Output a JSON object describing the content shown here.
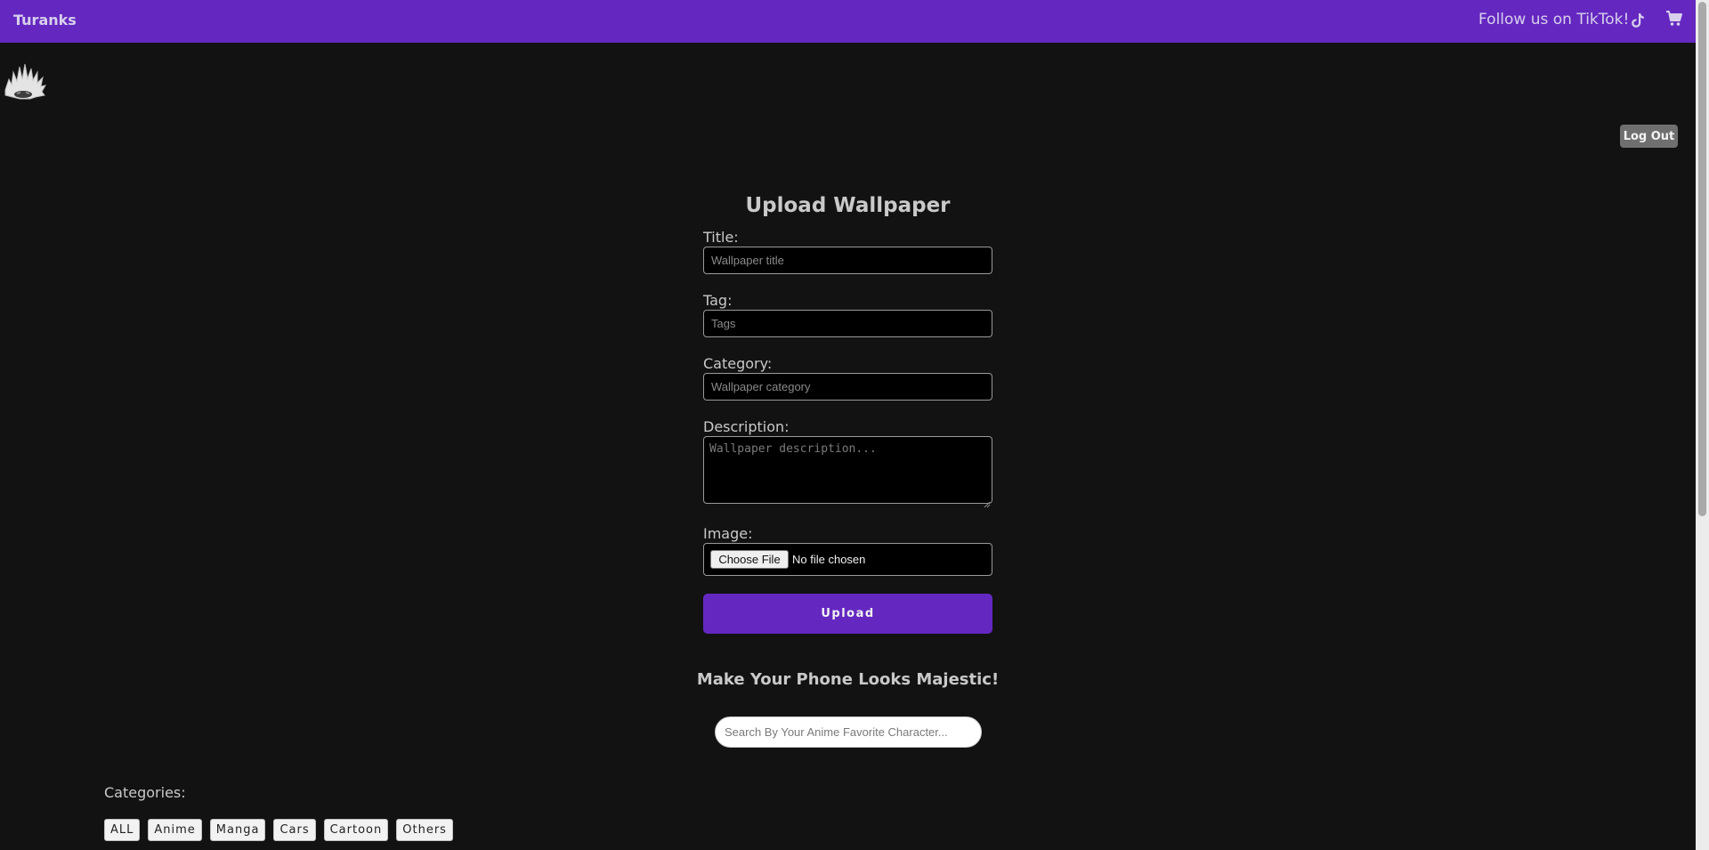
{
  "navbar": {
    "brand": "Turanks",
    "follow_text": "Follow us on TikTok!",
    "icons": [
      "tiktok-icon",
      "cart-icon"
    ],
    "background": "#6428c0"
  },
  "account": {
    "logout_label": "Log Out"
  },
  "upload_form": {
    "title": "Upload Wallpaper",
    "fields": {
      "title_label": "Title:",
      "title_placeholder": "Wallpaper title",
      "tag_label": "Tag:",
      "tag_placeholder": "Tags",
      "category_label": "Category:",
      "category_placeholder": "Wallpaper category",
      "description_label": "Description:",
      "description_placeholder": "Wallpaper description...",
      "image_label": "Image:",
      "choose_file_label": "Choose File",
      "file_status": "No file chosen"
    },
    "submit_label": "Upload"
  },
  "hero": {
    "tagline": "Make Your Phone Looks Majestic!",
    "search_placeholder": "Search By Your Anime Favorite Character..."
  },
  "categories": {
    "label": "Categories:",
    "items": [
      "ALL",
      "Anime",
      "Manga",
      "Cars",
      "Cartoon",
      "Others"
    ]
  }
}
